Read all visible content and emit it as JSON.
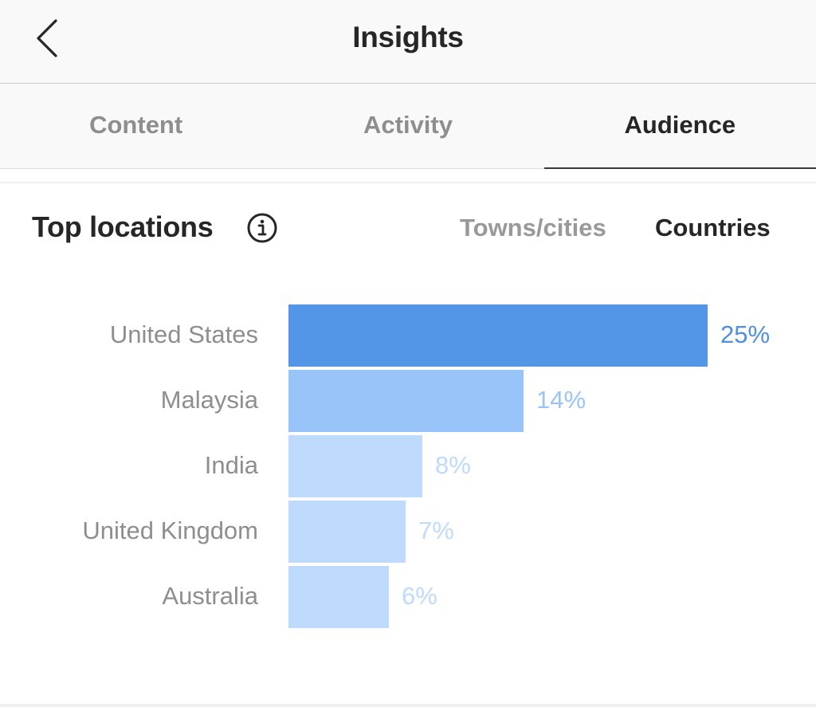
{
  "navbar": {
    "title": "Insights",
    "back_icon": "chevron-left-icon"
  },
  "tabs": [
    {
      "label": "Content",
      "active": false
    },
    {
      "label": "Activity",
      "active": false
    },
    {
      "label": "Audience",
      "active": true
    }
  ],
  "section": {
    "title": "Top locations",
    "info_icon": "info-circle-icon",
    "toggles": {
      "cities": "Towns/cities",
      "countries": "Countries",
      "selected": "Countries"
    }
  },
  "colors": {
    "primary_bar": "#5395e6",
    "secondary_bar": "#99c4fa",
    "tertiary_bar": "#bedafc",
    "primary_label": "#4f8fe0",
    "secondary_label": "#99c4fa",
    "tertiary_label": "#bedafc"
  },
  "chart_data": {
    "type": "bar",
    "orientation": "horizontal",
    "title": "Top locations",
    "categories": [
      "United States",
      "Malaysia",
      "India",
      "United Kingdom",
      "Australia"
    ],
    "values": [
      25,
      14,
      8,
      7,
      6
    ],
    "value_labels": [
      "25%",
      "14%",
      "8%",
      "7%",
      "6%"
    ],
    "unit": "%",
    "xlabel": "",
    "ylabel": "",
    "xlim": [
      0,
      25
    ],
    "grid": false,
    "legend": "none"
  }
}
